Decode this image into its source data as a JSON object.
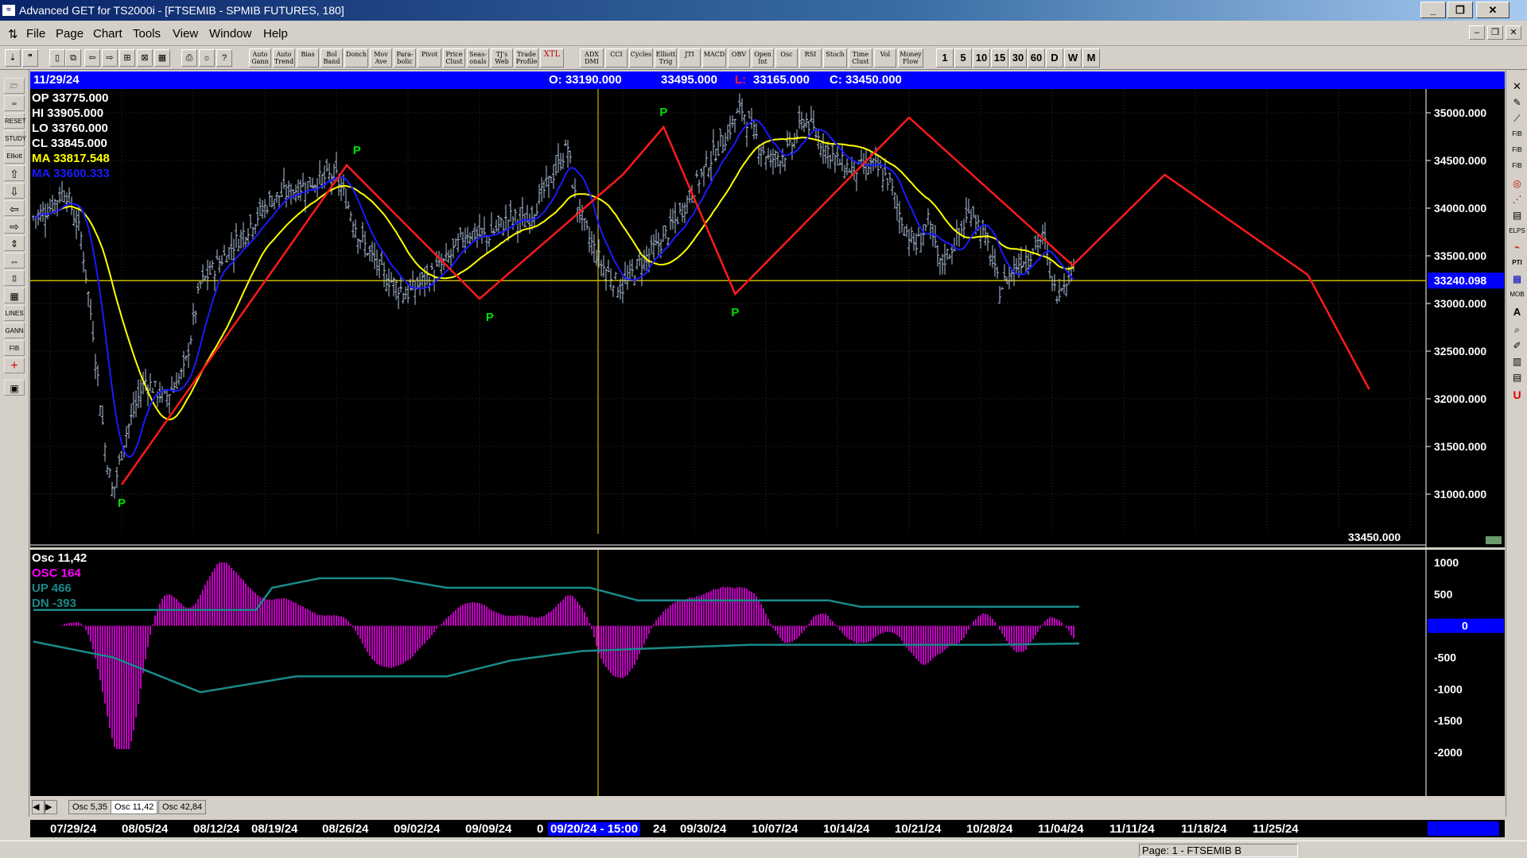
{
  "window": {
    "title": "Advanced GET for TS2000i - [FTSEMIB - SPMIB FUTURES, 180]"
  },
  "menu": [
    "File",
    "Page",
    "Chart",
    "Tools",
    "View",
    "Window",
    "Help"
  ],
  "toolbar": {
    "indicators": [
      "Auto Gann",
      "Auto Trend",
      "Bias",
      "Bol Band",
      "Donch",
      "Mov Ave",
      "Para- bolic",
      "Pivot",
      "Price Clust",
      "Seas- onals",
      "TJ's Web",
      "Trade Profile",
      "XTL",
      "ADX DMI",
      "CCI",
      "Cycles",
      "Elliott Trig",
      "JTI",
      "MACD",
      "OBV",
      "Open Int",
      "Osc",
      "RSI",
      "Stoch",
      "Time Clust",
      "Vol",
      "Money Flow"
    ],
    "timeframes": [
      "1",
      "5",
      "10",
      "15",
      "30",
      "60",
      "D",
      "W",
      "M"
    ]
  },
  "infobar": {
    "date": "11/29/24",
    "open": "O: 33190.000",
    "high": "33495.000",
    "low_label": "L:",
    "low": "33165.000",
    "close": "C: 33450.000"
  },
  "legend": {
    "op": "OP  33775.000",
    "hi": "HI   33905.000",
    "lo": "LO  33760.000",
    "cl": "CL  33845.000",
    "ma": "MA  33817.548",
    "ma2": "MA  33600.333"
  },
  "price_axis": {
    "ticks": [
      "35000.000",
      "34500.000",
      "34000.000",
      "33500.000",
      "33000.000",
      "32500.000",
      "32000.000",
      "31500.000",
      "31000.000"
    ],
    "current": "33240.098",
    "last": "33450.000"
  },
  "osc_legend": {
    "title": "Osc 11,42",
    "osc": "OSC 164",
    "up": "UP   466",
    "dn": "DN   -393"
  },
  "osc_axis": {
    "ticks": [
      "1000",
      "500",
      "0",
      "-500",
      "-1000",
      "-1500",
      "-2000"
    ]
  },
  "tabs": [
    "Osc 5,35",
    "Osc 11,42",
    "Osc 42,84"
  ],
  "dates": [
    "07/29/24",
    "08/05/24",
    "08/12/24",
    "08/19/24",
    "08/26/24",
    "09/02/24",
    "09/09/24",
    "0",
    "09/20/24 - 15:00",
    "24",
    "09/30/24",
    "10/07/24",
    "10/14/24",
    "10/21/24",
    "10/28/24",
    "11/04/24",
    "11/11/24",
    "11/18/24",
    "11/25/24"
  ],
  "pivot_label": "P",
  "status": {
    "page": "Page: 1 - FTSEMIB B"
  },
  "colors": {
    "ma_fast": "#ffff00",
    "ma_slow": "#1a1aff",
    "zigzag": "#ff1a1a",
    "osc": "#ff00ff",
    "band": "#1a8a8a",
    "bars": "#b0c4e0",
    "pivot": "#00e000"
  },
  "chart_data": {
    "type": "line",
    "title": "FTSEMIB - SPMIB FUTURES, 180",
    "ylim": [
      30500,
      35200
    ],
    "xlim": [
      "07/29/24",
      "12/03/24"
    ],
    "series": [
      {
        "name": "Elliott zigzag",
        "x": [
          "08/05/24",
          "08/27/24",
          "09/09/24",
          "09/23/24",
          "09/27/24",
          "10/04/24",
          "10/21/24",
          "11/06/24",
          "11/15/24",
          "11/29/24",
          "12/05/24"
        ],
        "values": [
          31100,
          34450,
          33050,
          34350,
          34850,
          33100,
          34950,
          33400,
          34350,
          33300,
          32100
        ]
      }
    ],
    "pivots": [
      {
        "x": "08/05/24",
        "label": "P"
      },
      {
        "x": "08/28/24",
        "label": "P"
      },
      {
        "x": "09/10/24",
        "label": "P"
      },
      {
        "x": "09/27/24",
        "label": "P"
      },
      {
        "x": "10/04/24",
        "label": "P"
      }
    ],
    "horizontal_line": 33240.098,
    "oscillator": {
      "name": "Osc 11,42",
      "ylim": [
        -2000,
        1000
      ],
      "osc_value": 164,
      "up": 466,
      "dn": -393
    }
  }
}
